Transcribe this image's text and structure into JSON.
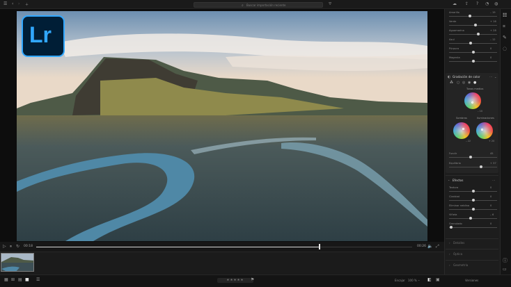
{
  "search": {
    "placeholder": "Buscar importación reciente"
  },
  "video": {
    "current_time": "00:18",
    "total_time": "00:26"
  },
  "panel": {
    "basic_sliders": [
      {
        "label": "Amarillo",
        "value": "– 19",
        "knob": 0.43
      },
      {
        "label": "Verde",
        "value": "+ 16",
        "knob": 0.55
      },
      {
        "label": "Aguamarina",
        "value": "+ 28",
        "knob": 0.62
      },
      {
        "label": "Azul",
        "value": "– 12",
        "knob": 0.44
      },
      {
        "label": "Púrpura",
        "value": "0",
        "knob": 0.5
      },
      {
        "label": "Magenta",
        "value": "0",
        "knob": 0.5
      }
    ],
    "color_grading": {
      "title": "Gradación de color",
      "tab_label": "Todo",
      "midtones_label": "Tonos medios",
      "midtones_value": "– 10",
      "shadows_label": "Sombras",
      "shadows_value": "– 22",
      "highlights_label": "Iluminaciones",
      "highlights_value": "+ 20",
      "blend_label": "Fundir",
      "blend_value": "45",
      "blend_knob": 0.45,
      "balance_label": "Equilibrio",
      "balance_value": "+ 37",
      "balance_knob": 0.68
    },
    "effects": {
      "title": "Efectos",
      "sliders": [
        {
          "label": "Textura",
          "value": "0",
          "knob": 0.5
        },
        {
          "label": "Claridad",
          "value": "0",
          "knob": 0.5
        },
        {
          "label": "Eliminar neblina",
          "value": "0",
          "knob": 0.5
        },
        {
          "label": "Viñeta",
          "value": "– 6",
          "knob": 0.45
        },
        {
          "label": "Granulado",
          "value": "0",
          "knob": 0.02
        }
      ]
    },
    "collapsed_sections": [
      "Detalles",
      "Óptica",
      "Geometría"
    ]
  },
  "bottom": {
    "stars": "★★★★★",
    "fit_label": "Encajar",
    "zoom_label": "100 %",
    "versions_label": "Versiones"
  }
}
